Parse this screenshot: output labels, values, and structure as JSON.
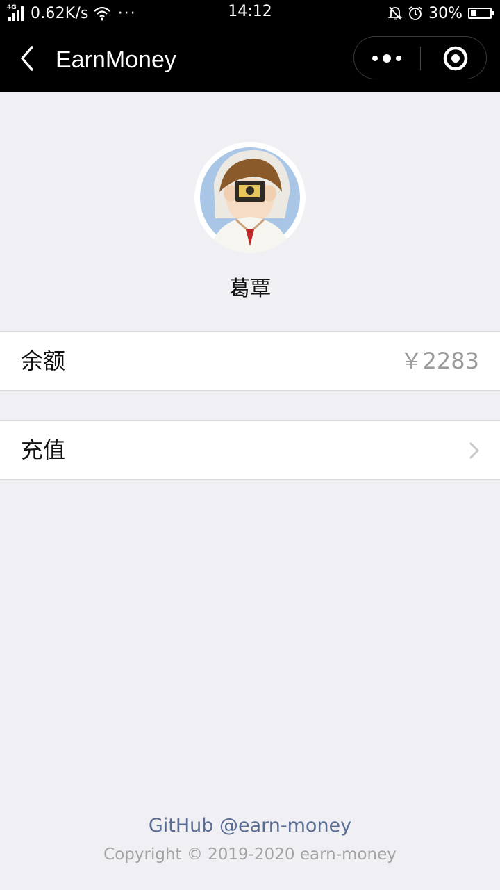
{
  "status_bar": {
    "network_type": "4G",
    "speed": "0.62K/s",
    "more": "···",
    "time": "14:12",
    "battery": "30%",
    "battery_level": 0.3,
    "icons": [
      "signal-icon",
      "wifi-icon",
      "mute-bell-icon",
      "alarm-icon",
      "battery-icon"
    ]
  },
  "nav": {
    "title": "EarnMoney",
    "back_icon": "chevron-left-icon",
    "more_icon": "more-dots-icon",
    "close_icon": "target-close-icon"
  },
  "profile": {
    "username": "葛覃"
  },
  "cells": {
    "balance": {
      "label": "余额",
      "value": "￥2283"
    },
    "recharge": {
      "label": "充值",
      "icon": "chevron-right-icon"
    }
  },
  "footer": {
    "link": "GitHub @earn-money",
    "copyright": "Copyright © 2019-2020 earn-money"
  },
  "colors": {
    "background": "#efeff4",
    "navbar": "#000000",
    "link": "#586c94",
    "muted": "#9b9b9b"
  }
}
